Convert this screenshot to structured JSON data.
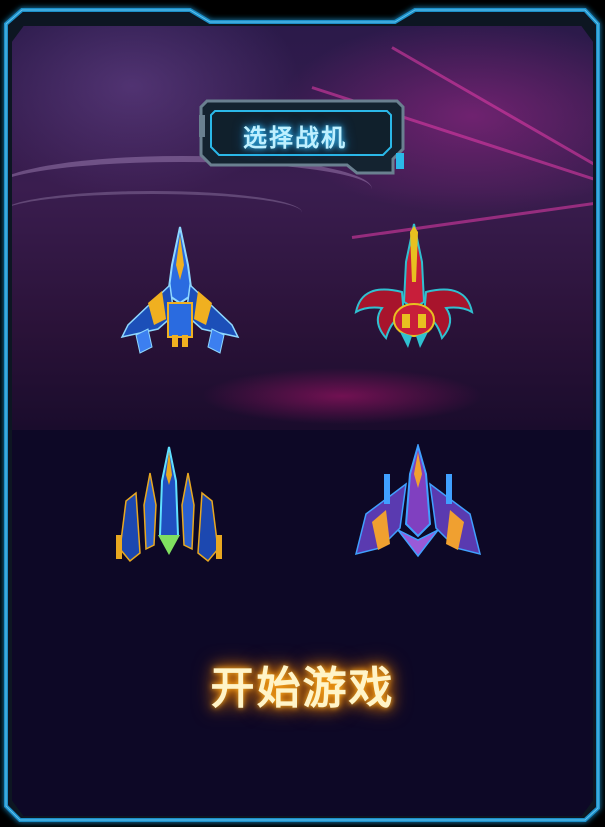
{
  "screen": {
    "title": "选择战机",
    "start_button_label": "开始游戏"
  },
  "ships": [
    {
      "id": "ship-1",
      "palette": [
        "#2a6be0",
        "#f0b020",
        "#8fd8ff"
      ]
    },
    {
      "id": "ship-2",
      "palette": [
        "#c81e3a",
        "#e8c020",
        "#30c0d0"
      ]
    },
    {
      "id": "ship-3",
      "palette": [
        "#2050c0",
        "#e8a820",
        "#60e0ff"
      ]
    },
    {
      "id": "ship-4",
      "palette": [
        "#8040c0",
        "#f0a030",
        "#40a0ff"
      ]
    }
  ],
  "colors": {
    "frame_glow": "#2aa8e0",
    "title_glow": "#38c8ff",
    "start_glow": "#ff9a10",
    "panel": "#0d0826"
  }
}
